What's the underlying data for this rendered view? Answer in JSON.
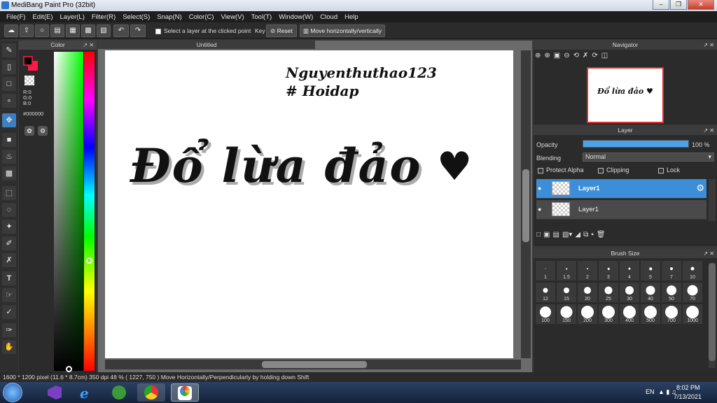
{
  "window": {
    "title": "MediBang Paint Pro (32bit)"
  },
  "menu": [
    "File(F)",
    "Edit(E)",
    "Layer(L)",
    "Filter(R)",
    "Select(S)",
    "Snap(N)",
    "Color(C)",
    "View(V)",
    "Tool(T)",
    "Window(W)",
    "Cloud",
    "Help"
  ],
  "toolbar": {
    "select_layer_label": "Select a layer at the clicked point",
    "key_label": "Key",
    "reset_label": "Reset",
    "move_label": "Move horizontally/vertically"
  },
  "color_panel": {
    "title": "Color",
    "r": "R:0",
    "g": "G:0",
    "b": "B:0",
    "hex": "#000000"
  },
  "document": {
    "tab_title": "Untitled",
    "text_username": "Nguyenthuthao123",
    "text_hashtag": "# Hoidap",
    "text_main": "Đổ lừa đảo",
    "heart": "♥"
  },
  "navigator": {
    "title": "Navigator"
  },
  "layer_panel": {
    "title": "Layer",
    "opacity_label": "Opacity",
    "opacity_value": "100 %",
    "opacity_fraction": 1.0,
    "blending_label": "Blending",
    "blending_value": "Normal",
    "protect_alpha": "Protect Alpha",
    "clipping": "Clipping",
    "lock": "Lock",
    "layers": [
      {
        "name": "Layer1",
        "selected": true
      },
      {
        "name": "Layer1",
        "selected": false
      }
    ]
  },
  "brush_size": {
    "title": "Brush Size",
    "sizes": [
      "1",
      "1.5",
      "2",
      "3",
      "4",
      "5",
      "7",
      "10",
      "12",
      "15",
      "20",
      "25",
      "30",
      "40",
      "50",
      "70",
      "100",
      "150",
      "200",
      "300",
      "400",
      "500",
      "700",
      "1000"
    ]
  },
  "status": {
    "text": "1600 * 1200 pixel   (11.6 * 8.7cm)   350 dpi   48 %   ( 1227, 750 )   Move Horizontally/Perpendicularly by holding down Shift"
  },
  "taskbar": {
    "language": "EN",
    "time": "8:02 PM",
    "date": "7/13/2021"
  },
  "colors": {
    "accent": "#3d8ed8",
    "foreground": "#000000",
    "background_swatch": "#ff1a4a"
  }
}
